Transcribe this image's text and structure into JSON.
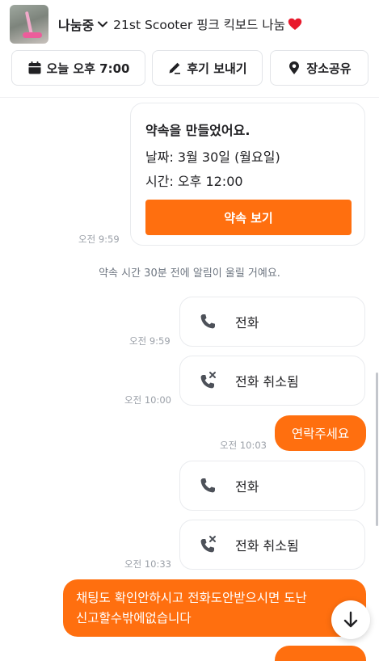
{
  "header": {
    "status": "나눔중",
    "title": "21st Scooter 핑크 킥보드 나눔",
    "thumbnail_icon": "pink-scooter-photo",
    "heart_icon": "red-heart-emoji"
  },
  "actions": {
    "schedule_label": "오늘 오후 7:00",
    "review_label": "후기 보내기",
    "location_label": "장소공유"
  },
  "appointment": {
    "title": "약속을 만들었어요.",
    "date_line": "날짜: 3월 30일 (월요일)",
    "time_line": "시간: 오후 12:00",
    "button_label": "약속 보기",
    "timestamp": "오전 9:59"
  },
  "system_message": "약속 시간 30분 전에 알림이 울릴 거예요.",
  "messages": [
    {
      "type": "call",
      "label": "전화",
      "time": "오전 9:59"
    },
    {
      "type": "call-cancelled",
      "label": "전화 취소됨",
      "time": "오전 10:00"
    },
    {
      "type": "text",
      "text": "연락주세요",
      "time": "오전 10:03"
    },
    {
      "type": "call",
      "label": "전화",
      "time": ""
    },
    {
      "type": "call-cancelled",
      "label": "전화 취소됨",
      "time": "오전 10:33"
    },
    {
      "type": "text",
      "line1": "채팅도 확인안하시고 전화도안받으시면 도난",
      "line2": "신고할수밖에없습니다"
    }
  ],
  "colors": {
    "accent": "#ff6f0f",
    "text": "#212124",
    "muted": "#9ba0a8",
    "border": "#e9ebee"
  }
}
